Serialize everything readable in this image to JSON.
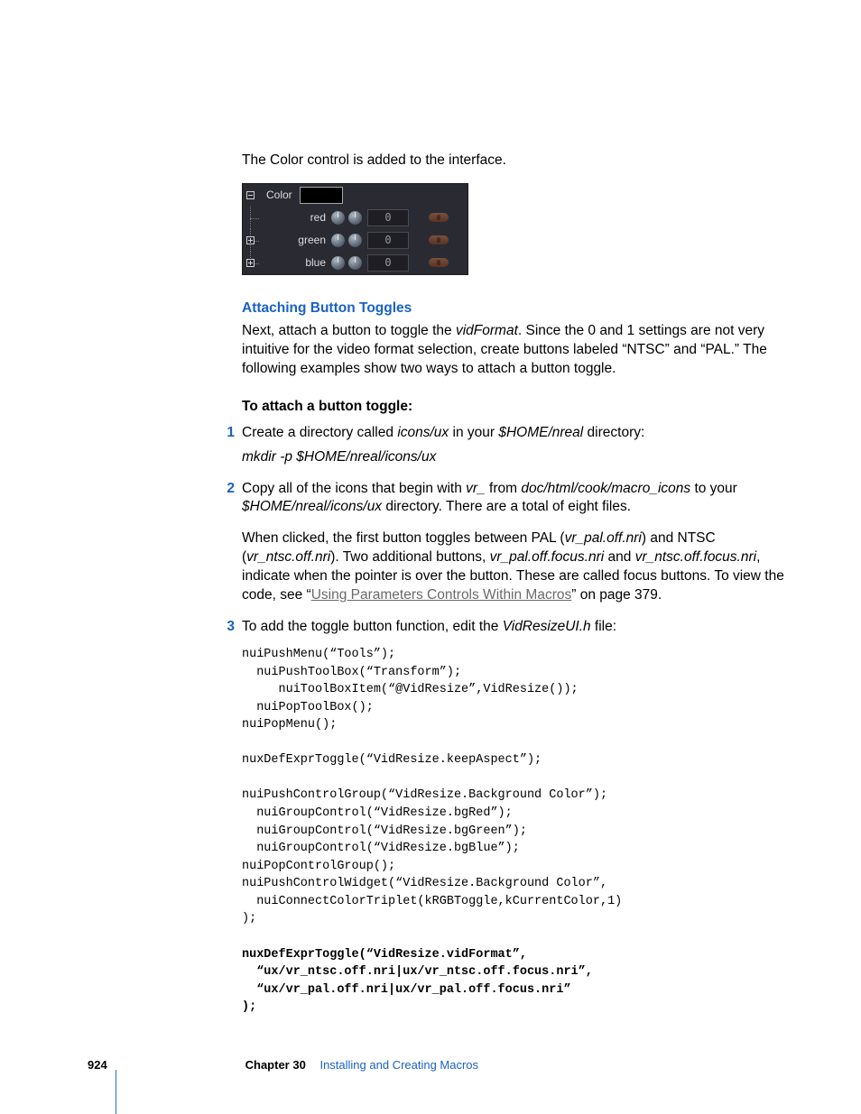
{
  "intro": "The Color control is added to the interface.",
  "fig": {
    "group_label": "Color",
    "rows": [
      {
        "label": "red",
        "value": "0"
      },
      {
        "label": "green",
        "value": "0"
      },
      {
        "label": "blue",
        "value": "0"
      }
    ]
  },
  "section_heading": "Attaching Button Toggles",
  "section_body_1a": "Next, attach a button to toggle the ",
  "section_body_1b": "vidFormat",
  "section_body_1c": ". Since the 0 and 1 settings are not very intuitive for the video format selection, create buttons labeled “NTSC” and “PAL.” The following examples show two ways to attach a button toggle.",
  "subheading": "To attach a button toggle:",
  "step1": {
    "a": "Create a directory called ",
    "b": "icons/ux",
    "c": " in your ",
    "d": "$HOME/nreal",
    "e": " directory:",
    "cmd": "mkdir -p $HOME/nreal/icons/ux"
  },
  "step2": {
    "a": "Copy all of the icons that begin with ",
    "b": "vr_",
    "c": " from ",
    "d": "doc/html/cook/macro_icons",
    "e": " to your ",
    "f": "$HOME/nreal/icons/ux",
    "g": " directory. There are a total of eight files.",
    "p2a": "When clicked, the first button toggles between PAL (",
    "p2b": "vr_pal.off.nri",
    "p2c": ") and NTSC (",
    "p2d": "vr_ntsc.off.nri",
    "p2e": "). Two additional buttons, ",
    "p2f": "vr_pal.off.focus.nri",
    "p2g": " and ",
    "p2h": "vr_ntsc.off.focus.nri",
    "p2i": ", indicate when the pointer is over the button. These are called focus buttons. To view the code, see “",
    "link": "Using Parameters Controls Within Macros",
    "p2j": "” on page 379."
  },
  "step3": {
    "a": "To add the toggle button function, edit the ",
    "b": "VidResizeUI.h",
    "c": " file:",
    "code": "nuiPushMenu(“Tools”);\n  nuiPushToolBox(“Transform”);\n     nuiToolBoxItem(“@VidResize”,VidResize());\n  nuiPopToolBox();\nnuiPopMenu();\n\nnuxDefExprToggle(“VidResize.keepAspect”);\n\nnuiPushControlGroup(“VidResize.Background Color”);\n  nuiGroupControl(“VidResize.bgRed”);\n  nuiGroupControl(“VidResize.bgGreen”);\n  nuiGroupControl(“VidResize.bgBlue”);\nnuiPopControlGroup();\nnuiPushControlWidget(“VidResize.Background Color”,\n  nuiConnectColorTriplet(kRGBToggle,kCurrentColor,1)\n);\n\nnuxDefExprToggle(“VidResize.vidFormat”,\n  “ux/vr_ntsc.off.nri|ux/vr_ntsc.off.focus.nri”,\n  “ux/vr_pal.off.nri|ux/vr_pal.off.focus.nri”\n);"
  },
  "footer": {
    "page": "924",
    "chapter_label": "Chapter 30",
    "chapter_title": "Installing and Creating Macros"
  }
}
